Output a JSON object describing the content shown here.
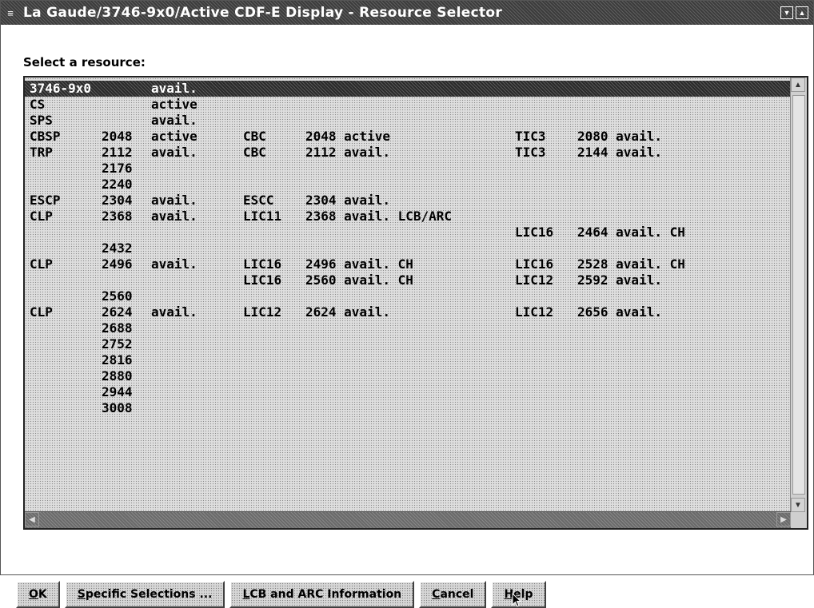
{
  "window": {
    "title": "La Gaude/3746-9x0/Active CDF-E Display - Resource Selector",
    "sysmenu_icon": "system-menu-icon"
  },
  "prompt": "Select a resource:",
  "rows": [
    [
      "3746-9x0",
      "",
      "avail.",
      "",
      "",
      "",
      ""
    ],
    [
      "CS",
      "",
      "active",
      "",
      "",
      "",
      ""
    ],
    [
      "SPS",
      "",
      "avail.",
      "",
      "",
      "",
      ""
    ],
    [
      "CBSP",
      "2048",
      "active",
      "CBC",
      "2048 active",
      "TIC3",
      "2080 avail."
    ],
    [
      "TRP",
      "2112",
      "avail.",
      "CBC",
      "2112 avail.",
      "TIC3",
      "2144 avail."
    ],
    [
      "",
      "2176",
      "",
      "",
      "",
      "",
      ""
    ],
    [
      "",
      "2240",
      "",
      "",
      "",
      "",
      ""
    ],
    [
      "ESCP",
      "2304",
      "avail.",
      "ESCC",
      "2304 avail.",
      "",
      ""
    ],
    [
      "CLP",
      "2368",
      "avail.",
      "LIC11",
      "2368 avail. LCB/ARC",
      "",
      ""
    ],
    [
      "",
      "",
      "",
      "",
      "",
      "LIC16",
      "2464 avail. CH"
    ],
    [
      "",
      "2432",
      "",
      "",
      "",
      "",
      ""
    ],
    [
      "CLP",
      "2496",
      "avail.",
      "LIC16",
      "2496 avail. CH",
      "LIC16",
      "2528 avail. CH"
    ],
    [
      "",
      "",
      "",
      "LIC16",
      "2560 avail. CH",
      "LIC12",
      "2592 avail."
    ],
    [
      "",
      "2560",
      "",
      "",
      "",
      "",
      ""
    ],
    [
      "CLP",
      "2624",
      "avail.",
      "LIC12",
      "2624 avail.",
      "LIC12",
      "2656 avail."
    ],
    [
      "",
      "2688",
      "",
      "",
      "",
      "",
      ""
    ],
    [
      "",
      "2752",
      "",
      "",
      "",
      "",
      ""
    ],
    [
      "",
      "2816",
      "",
      "",
      "",
      "",
      ""
    ],
    [
      "",
      "2880",
      "",
      "",
      "",
      "",
      ""
    ],
    [
      "",
      "2944",
      "",
      "",
      "",
      "",
      ""
    ],
    [
      "",
      "3008",
      "",
      "",
      "",
      "",
      ""
    ]
  ],
  "selected_row": 0,
  "buttons": [
    {
      "name": "ok-button",
      "mnemonic": "O",
      "rest": "K"
    },
    {
      "name": "specific-selections-button",
      "mnemonic": "S",
      "rest": "pecific Selections ..."
    },
    {
      "name": "lcb-arc-information-button",
      "mnemonic": "L",
      "rest": "CB and ARC Information"
    },
    {
      "name": "cancel-button",
      "mnemonic": "C",
      "rest": "ancel"
    },
    {
      "name": "help-button",
      "mnemonic": "H",
      "rest": "elp"
    }
  ]
}
